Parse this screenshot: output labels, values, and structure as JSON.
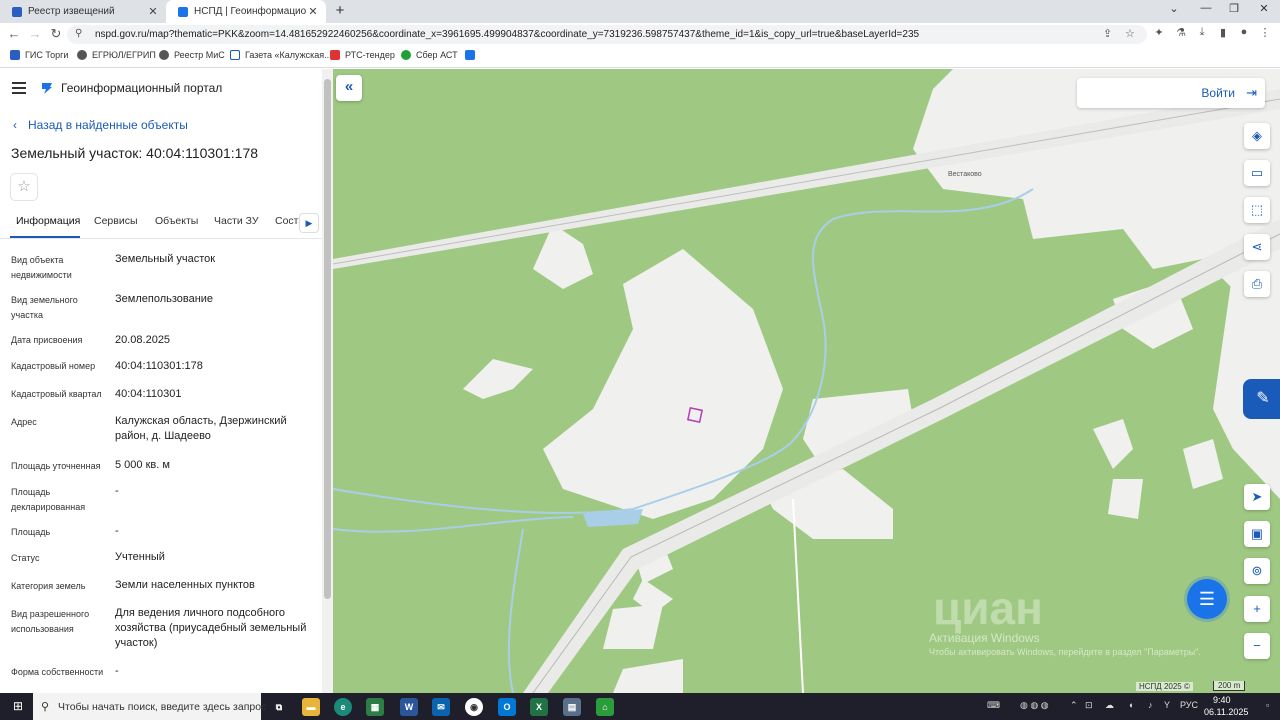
{
  "browser": {
    "tabs": [
      {
        "title": "Реестр извещений",
        "active": false
      },
      {
        "title": "НСПД | Геоинформационный п",
        "active": true
      }
    ],
    "url": "nspd.gov.ru/map?thematic=PKK&zoom=14.481652922460256&coordinate_x=3961695.499904837&coordinate_y=7319236.598757437&theme_id=1&is_copy_url=true&baseLayerId=235",
    "bookmarks": [
      "ГИС Торги",
      "ЕГРЮЛ/ЕГРИП",
      "Реестр МиС",
      "Газета «Калужская...",
      "РТС-тендер",
      "Сбер АСТ"
    ]
  },
  "panel": {
    "portal_title": "Геоинформационный портал",
    "back_label": "Назад в найденные объекты",
    "object_title": "Земельный участок: 40:04:110301:178",
    "tabs": [
      "Информация",
      "Сервисы",
      "Объекты",
      "Части ЗУ",
      "Соста"
    ],
    "properties": [
      {
        "label": "Вид объекта недвижимости",
        "value": "Земельный участок"
      },
      {
        "label": "Вид земельного участка",
        "value": "Землепользование"
      },
      {
        "label": "Дата присвоения",
        "value": "20.08.2025"
      },
      {
        "label": "Кадастровый номер",
        "value": "40:04:110301:178"
      },
      {
        "label": "Кадастровый квартал",
        "value": "40:04:110301"
      },
      {
        "label": "Адрес",
        "value": "Калужская область, Дзержинский район, д. Шадеево"
      },
      {
        "label": "Площадь уточненная",
        "value": "5 000 кв. м"
      },
      {
        "label": "Площадь декларированная",
        "value": "-"
      },
      {
        "label": "Площадь",
        "value": "-"
      },
      {
        "label": "Статус",
        "value": "Учтенный"
      },
      {
        "label": "Категория земель",
        "value": "Земли населенных пунктов"
      },
      {
        "label": "Вид разрешенного использования",
        "value": "Для ведения личного подсобного хозяйства (приусадебный земельный участок)"
      },
      {
        "label": "Форма собственности",
        "value": "-"
      }
    ]
  },
  "map": {
    "login_label": "Войти",
    "village_label": "Вестаково",
    "watermark": "циан",
    "activation_title": "Активация Windows",
    "activation_hint": "Чтобы активировать Windows, перейдите в раздел \"Параметры\".",
    "copyright": "НСПД 2025 ©",
    "scale_label": "200 m",
    "colors": {
      "forest": "#9fc982",
      "open_land": "#f0f0ee",
      "water": "#a9cfe8",
      "parcel": "#b23bb8",
      "accent": "#1a5ab8"
    }
  },
  "taskbar": {
    "search_placeholder": "Чтобы начать поиск, введите здесь запрос",
    "language": "РУС",
    "time": "9:40",
    "date": "06.11.2025"
  }
}
